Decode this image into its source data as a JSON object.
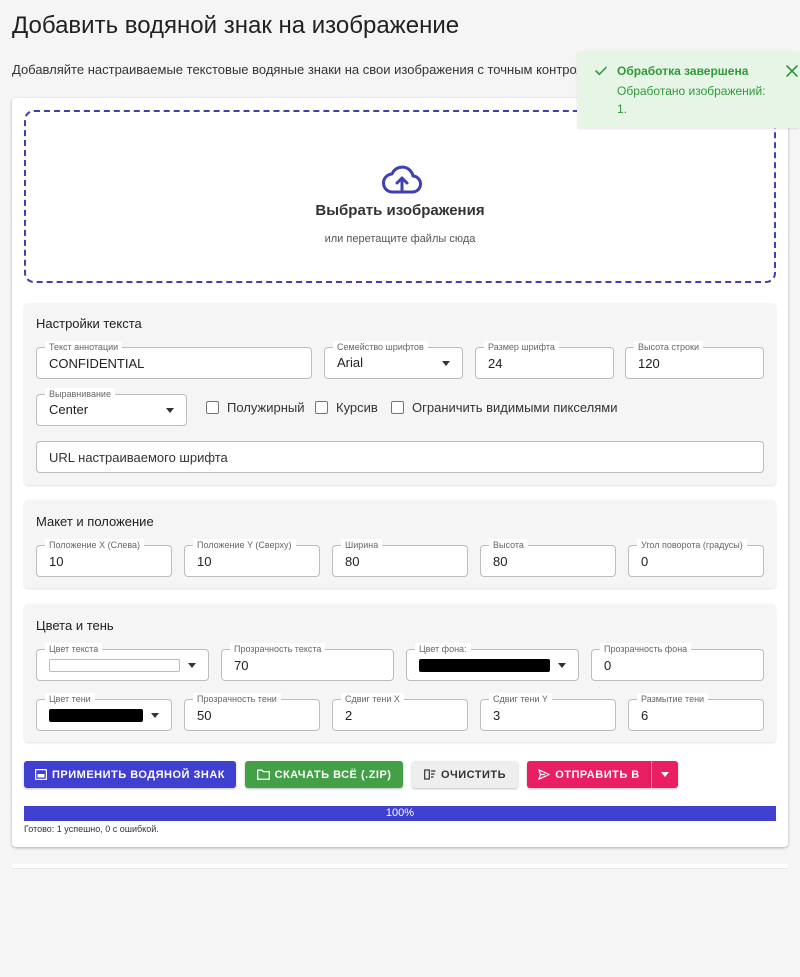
{
  "page": {
    "title": "Добавить водяной знак на изображение",
    "subtitle": "Добавляйте настраиваемые текстовые водяные знаки на свои изображения с точным контроле"
  },
  "dropzone": {
    "icon": "cloud-upload-icon",
    "title": "Выбрать изображения",
    "hint": "или перетащите файлы сюда"
  },
  "text_settings": {
    "title": "Настройки текста",
    "annotation_text": {
      "label": "Текст аннотации",
      "value": "CONFIDENTIAL"
    },
    "font_family": {
      "label": "Семейство шрифтов",
      "value": "Arial"
    },
    "font_size": {
      "label": "Размер шрифта",
      "value": "24"
    },
    "line_height": {
      "label": "Высота строки",
      "value": "120"
    },
    "alignment": {
      "label": "Выравнивание",
      "value": "Center"
    },
    "bold_label": "Полужирный",
    "italic_label": "Курсив",
    "clip_label": "Ограничить видимыми пикселями",
    "custom_font_placeholder": "URL настраиваемого шрифта"
  },
  "layout": {
    "title": "Макет и положение",
    "pos_x": {
      "label": "Положение X (Слева)",
      "value": "10"
    },
    "pos_y": {
      "label": "Положение Y (Сверху)",
      "value": "10"
    },
    "width": {
      "label": "Ширина",
      "value": "80"
    },
    "height": {
      "label": "Высота",
      "value": "80"
    },
    "rotation": {
      "label": "Угол поворота (градусы)",
      "value": "0"
    }
  },
  "colors": {
    "title": "Цвета и тень",
    "text_color": {
      "label": "Цвет текста",
      "color": "#ffffff"
    },
    "text_opacity": {
      "label": "Прозрачность текста",
      "value": "70"
    },
    "bg_color": {
      "label": "Цвет фона:",
      "color": "#000000"
    },
    "bg_opacity": {
      "label": "Прозрачность фона",
      "value": "0"
    },
    "shadow_color": {
      "label": "Цвет тени",
      "color": "#000000"
    },
    "shadow_opacity": {
      "label": "Прозрачность тени",
      "value": "50"
    },
    "shadow_x": {
      "label": "Сдвиг тени X",
      "value": "2"
    },
    "shadow_y": {
      "label": "Сдвиг тени Y",
      "value": "3"
    },
    "shadow_blur": {
      "label": "Размытие тени",
      "value": "6"
    }
  },
  "actions": {
    "apply": "ПРИМЕНИТЬ ВОДЯНОЙ ЗНАК",
    "download": "СКАЧАТЬ ВСЁ (.ZIP)",
    "clear": "ОЧИСТИТЬ",
    "send": "ОТПРАВИТЬ В"
  },
  "progress": {
    "label": "100%",
    "percent": 100,
    "status": "Готово: 1 успешно, 0 с ошибкой."
  },
  "toast": {
    "title": "Обработка завершена",
    "body": "Обработано изображений: 1."
  },
  "colors_theme": {
    "primary": "#3f3fd0",
    "success": "#43a047",
    "send": "#e91e63",
    "toast_bg": "#e6f5e6",
    "toast_text": "#2e9a3a"
  }
}
